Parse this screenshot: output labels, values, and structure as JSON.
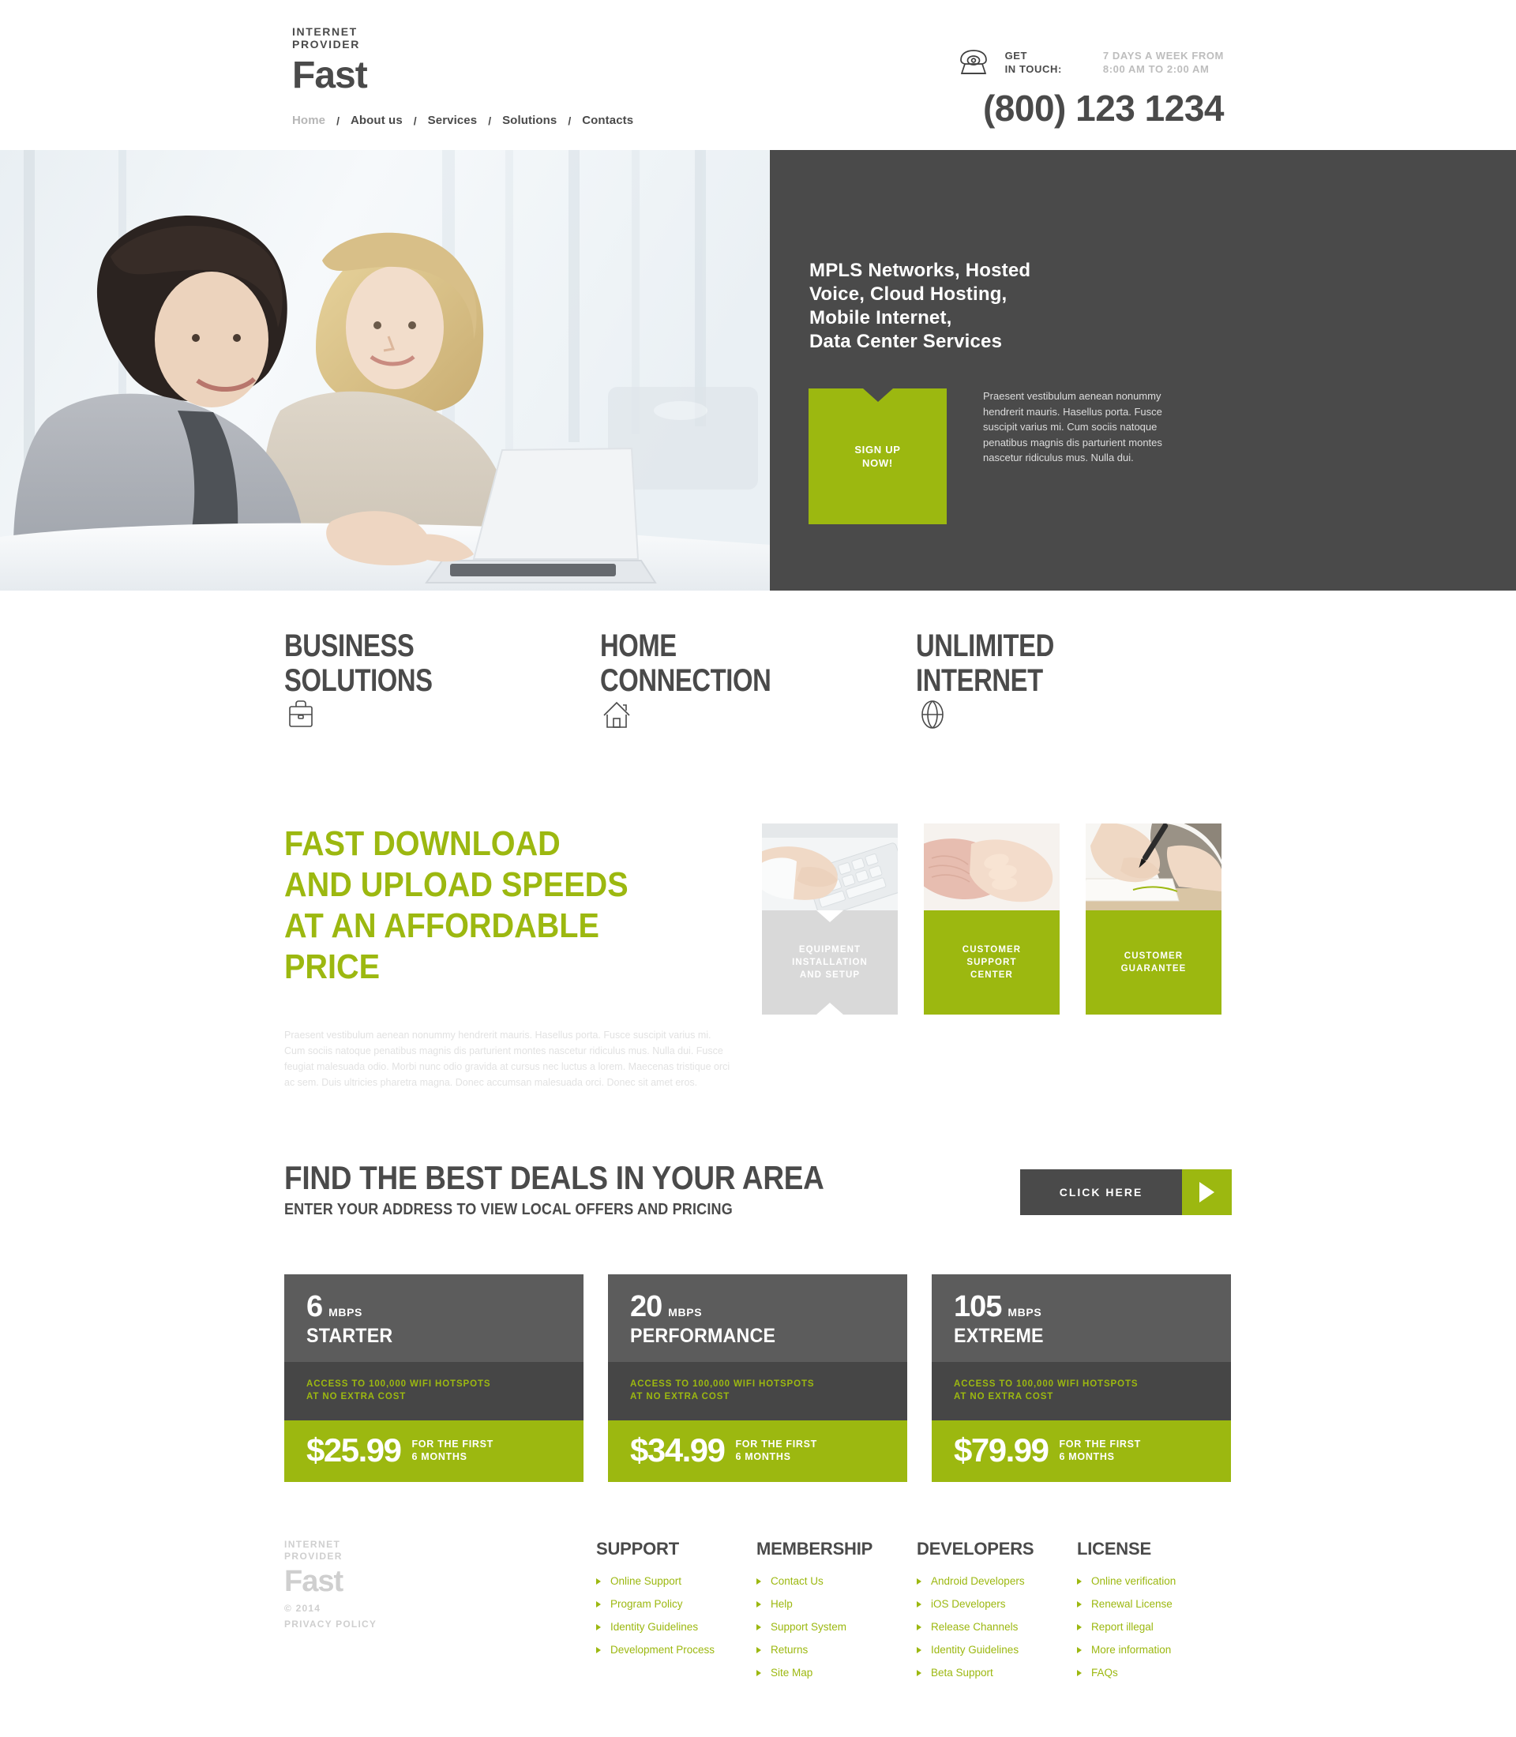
{
  "header": {
    "logo_kicker_line1": "INTERNET",
    "logo_kicker_line2": "PROVIDER",
    "logo_name": "Fast",
    "nav": [
      {
        "label": "Home",
        "active": true
      },
      {
        "label": "About us",
        "active": false
      },
      {
        "label": "Services",
        "active": false
      },
      {
        "label": "Solutions",
        "active": false
      },
      {
        "label": "Contacts",
        "active": false
      }
    ],
    "nav_separator": "/",
    "contact": {
      "icon": "telephone-icon",
      "get_in_touch_line1": "GET",
      "get_in_touch_line2": "IN TOUCH:",
      "hours_line1": "7 DAYS A WEEK FROM",
      "hours_line2": "8:00 AM TO 2:00 AM",
      "phone": "(800) 123 1234"
    }
  },
  "hero": {
    "photo_alt": "businessman-and-businesswoman-at-laptop-photo",
    "title": "MPLS Networks, Hosted\nVoice, Cloud Hosting,\nMobile Internet,\nData Center Services",
    "title_lines": [
      "MPLS Networks, Hosted",
      "Voice, Cloud Hosting,",
      "Mobile Internet,",
      "Data Center Services"
    ],
    "cta_line1": "SIGN UP",
    "cta_line2": "NOW!",
    "paragraph": "Praesent vestibulum aenean nonummy hendrerit mauris. Hasellus porta. Fusce suscipit varius mi. Cum sociis natoque penatibus magnis dis parturient montes nascetur ridiculus mus. Nulla dui."
  },
  "services": [
    {
      "title_line1": "BUSINESS",
      "title_line2": "SOLUTIONS",
      "icon": "briefcase-icon"
    },
    {
      "title_line1": "HOME",
      "title_line2": "CONNECTION",
      "icon": "house-icon"
    },
    {
      "title_line1": "UNLIMITED",
      "title_line2": "INTERNET",
      "icon": "globe-icon"
    }
  ],
  "promo": {
    "heading_lines": [
      "FAST DOWNLOAD",
      "AND UPLOAD SPEEDS",
      "AT AN AFFORDABLE",
      "PRICE"
    ],
    "paragraph": "Praesent vestibulum aenean nonummy hendrerit mauris. Hasellus porta. Fusce suscipit varius mi. Cum sociis natoque penatibus magnis dis parturient montes nascetur  ridiculus mus. Nulla dui. Fusce feugiat malesuada odio. Morbi nunc odio gravida at cursus nec luctus a lorem. Maecenas tristique orci ac sem. Duis ultricies pharetra magna. Donec accumsan malesuada orci. Donec sit amet eros.",
    "cards": [
      {
        "caption_lines": [
          "EQUIPMENT",
          "INSTALLATION",
          "AND SETUP"
        ],
        "style": "grey",
        "image": "hands-typing-on-keyboard-photo"
      },
      {
        "caption_lines": [
          "CUSTOMER",
          "SUPPORT",
          "CENTER"
        ],
        "style": "green",
        "image": "holding-hands-photo"
      },
      {
        "caption_lines": [
          "CUSTOMER",
          "GUARANTEE"
        ],
        "style": "green",
        "image": "signing-document-photo"
      }
    ]
  },
  "deals": {
    "heading": "FIND THE BEST DEALS IN YOUR AREA",
    "subheading": "ENTER YOUR ADDRESS TO VIEW LOCAL OFFERS AND PRICING",
    "button_label": "CLICK HERE",
    "button_icon": "play-arrow-icon"
  },
  "pricing": {
    "feature_line1": "ACCESS TO 100,000 WIFI HOTSPOTS",
    "feature_line2": "AT NO EXTRA COST",
    "term_line1": "FOR THE FIRST",
    "term_line2": "6 MONTHS",
    "unit": "MBPS",
    "plans": [
      {
        "speed": "6",
        "name": "STARTER",
        "price": "$25.99"
      },
      {
        "speed": "20",
        "name": "PERFORMANCE",
        "price": "$34.99"
      },
      {
        "speed": "105",
        "name": "EXTREME",
        "price": "$79.99"
      }
    ]
  },
  "footer": {
    "logo_kicker_line1": "INTERNET",
    "logo_kicker_line2": "PROVIDER",
    "logo_name": "Fast",
    "copyright": "© 2014",
    "privacy": "PRIVACY POLICY",
    "columns": [
      {
        "title": "SUPPORT",
        "links": [
          "Online Support",
          "Program Policy",
          "Identity Guidelines",
          "Development Process"
        ]
      },
      {
        "title": "MEMBERSHIP",
        "links": [
          "Contact Us",
          "Help",
          "Support System",
          "Returns",
          "Site Map"
        ]
      },
      {
        "title": "DEVELOPERS",
        "links": [
          "Android Developers",
          "iOS Developers",
          "Release Channels",
          "Identity Guidelines",
          "Beta Support"
        ]
      },
      {
        "title": "LICENSE",
        "links": [
          "Online verification",
          "Renewal License",
          "Report illegal",
          "More information",
          "FAQs"
        ]
      }
    ]
  },
  "colors": {
    "accent_green": "#9cb810",
    "dark": "#4a4a4a",
    "dark_mid": "#5c5c5c",
    "dark_deep": "#464646",
    "grey_caption": "#d9d9d9",
    "muted_text": "#bdbdbd"
  }
}
